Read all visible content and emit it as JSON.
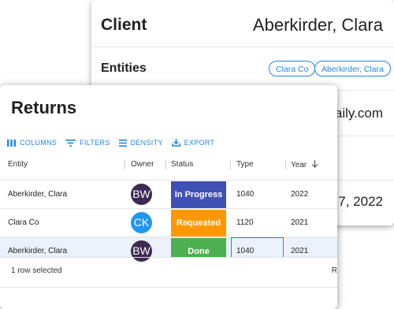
{
  "client": {
    "title": "Client",
    "name": "Aberkirder, Clara",
    "entities_label": "Entities",
    "entities": [
      "Clara Co",
      "Aberkirder, Clara"
    ],
    "email_partial": "aily.com",
    "date_partial": "7, 2022"
  },
  "returns": {
    "title": "Returns",
    "toolbar": {
      "columns": "COLUMNS",
      "filters": "FILTERS",
      "density": "DENSITY",
      "export": "EXPORT"
    },
    "columns": {
      "entity": "Entity",
      "owner": "Owner",
      "status": "Status",
      "type": "Type",
      "year": "Year"
    },
    "rows": [
      {
        "entity": "Aberkirder, Clara",
        "owner": "BW",
        "owner_color": "#3b2a52",
        "status": "In Progress",
        "status_color": "#3f51b5",
        "type": "1040",
        "year": "2022",
        "selected": false
      },
      {
        "entity": "Clara Co",
        "owner": "CK",
        "owner_color": "#2196f3",
        "status": "Requested",
        "status_color": "#ff9800",
        "type": "1120",
        "year": "2021",
        "selected": false
      },
      {
        "entity": "Aberkirder, Clara",
        "owner": "BW",
        "owner_color": "#3b2a52",
        "status": "Done",
        "status_color": "#4caf50",
        "type": "1040",
        "year": "2021",
        "selected": true
      }
    ],
    "footer": {
      "selection": "1 row selected",
      "pager_partial": "R"
    }
  },
  "colors": {
    "accent": "#1e88e5",
    "selected_row": "#eaf1fb"
  }
}
